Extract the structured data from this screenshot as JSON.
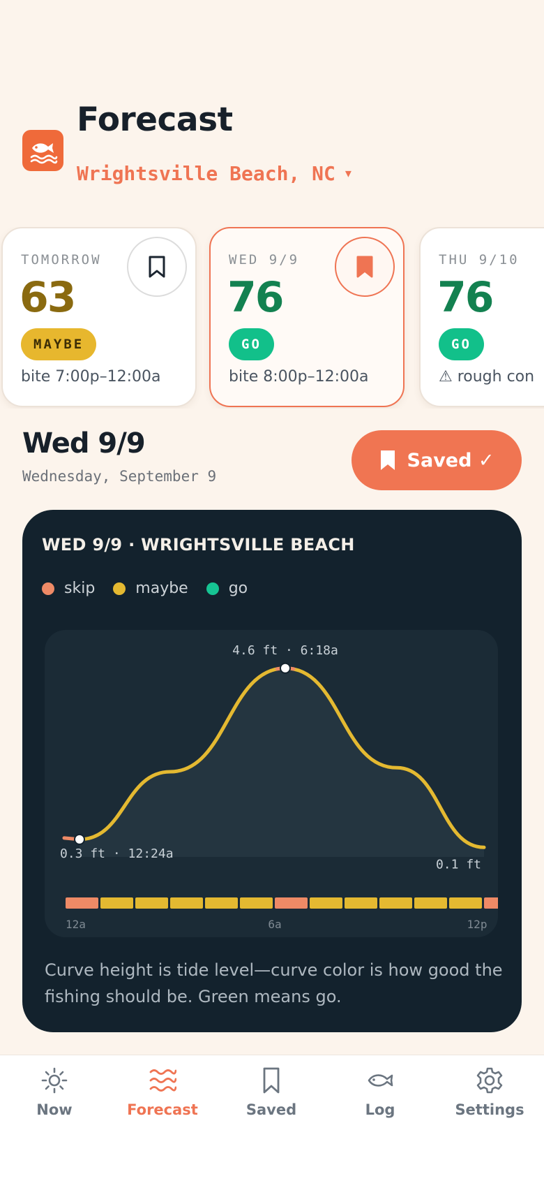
{
  "header": {
    "title": "Forecast",
    "location": "Wrightsville Beach, NC",
    "location_caret": "▾"
  },
  "day_cards": [
    {
      "label": "TOMORROW",
      "score": "63",
      "verdict": "MAYBE",
      "bite": "bite 7:00p–12:00a",
      "saved": false
    },
    {
      "label": "WED 9/9",
      "score": "76",
      "verdict": "GO",
      "bite": "bite 8:00p–12:00a",
      "saved": true
    },
    {
      "label": "THU 9/10",
      "score": "76",
      "verdict": "GO",
      "bite": "⚠ rough con",
      "saved": false
    }
  ],
  "detail": {
    "day_title": "Wed 9/9",
    "day_subtitle": "Wednesday, September 9",
    "saved_label": "Saved ✓"
  },
  "chart_card": {
    "title": "WED 9/9 · WRIGHTSVILLE BEACH",
    "legend": [
      {
        "label": "skip",
        "color": "#ee8a66"
      },
      {
        "label": "maybe",
        "color": "#e4b931"
      },
      {
        "label": "go",
        "color": "#16c493"
      }
    ],
    "caption": "Curve height is tide level—curve color is how good the fishing should be. Green means go."
  },
  "chart_data": {
    "type": "line",
    "x_unit": "hour",
    "y_unit": "ft",
    "series": [
      {
        "x": [
          0.4,
          3.0,
          6.3,
          9.5,
          12.0
        ],
        "values": [
          0.3,
          2.0,
          4.6,
          2.1,
          0.1
        ]
      }
    ],
    "annotations": [
      {
        "label": "0.3 ft · 12:24a",
        "x": 0.4,
        "y": 0.3
      },
      {
        "label": "4.6 ft · 6:18a",
        "x": 6.3,
        "y": 4.6
      },
      {
        "label": "0.1 ft",
        "x": 12.0,
        "y": 0.1
      }
    ],
    "tick_labels": [
      "12a",
      "6a",
      "12p"
    ],
    "hourly_rating": [
      "skip",
      "maybe",
      "maybe",
      "maybe",
      "maybe",
      "maybe",
      "skip",
      "maybe",
      "maybe",
      "maybe",
      "maybe",
      "maybe",
      "skip"
    ],
    "colors": {
      "skip": "#ee8a66",
      "maybe": "#e4b931",
      "go": "#16c493"
    }
  },
  "nav": {
    "items": [
      {
        "label": "Now",
        "icon": "sun-icon",
        "active": false
      },
      {
        "label": "Forecast",
        "icon": "waves-icon",
        "active": true
      },
      {
        "label": "Saved",
        "icon": "bookmark-icon",
        "active": false
      },
      {
        "label": "Log",
        "icon": "fish-icon",
        "active": false
      },
      {
        "label": "Settings",
        "icon": "gear-icon",
        "active": false
      }
    ]
  }
}
